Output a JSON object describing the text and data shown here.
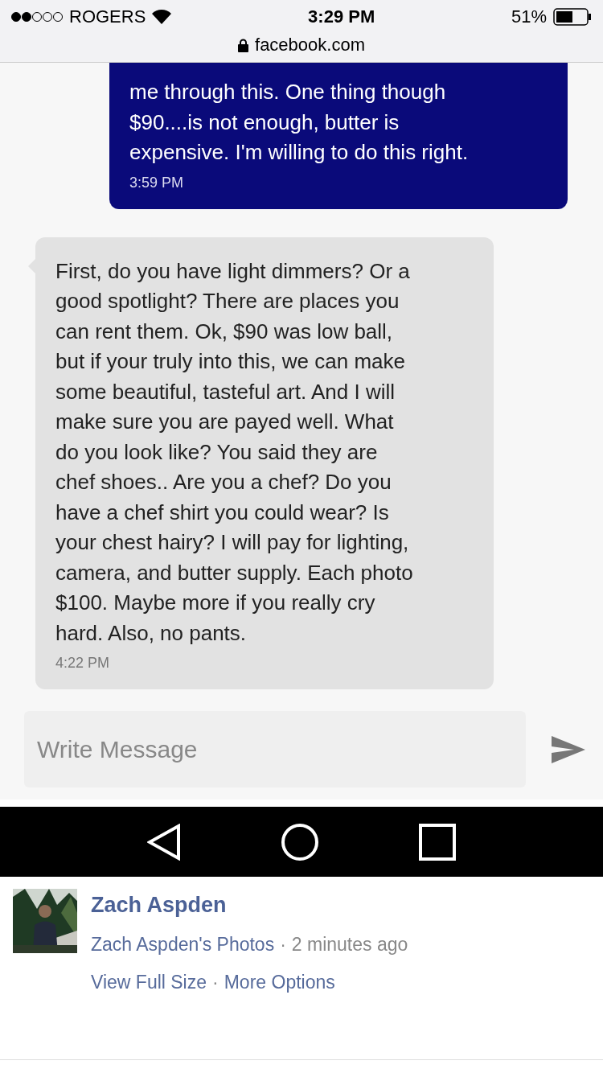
{
  "status_bar": {
    "carrier": "ROGERS",
    "time": "3:29 PM",
    "battery": "51%",
    "url": "facebook.com"
  },
  "messages": [
    {
      "kind": "sent",
      "text": "me through this. One thing though\n$90....is not enough, butter is\nexpensive. I'm willing to do this right.",
      "time": "3:59 PM"
    },
    {
      "kind": "received",
      "text": "First, do you have light dimmers? Or a\ngood spotlight? There are places you\ncan rent them. Ok, $90 was low ball,\nbut if your truly into this, we can make\nsome beautiful, tasteful art. And I will\nmake sure you are payed well. What\ndo you look like? You said they are\nchef shoes.. Are you a chef? Do you\nhave a chef shirt you could wear? Is\nyour chest hairy? I will pay for lighting,\ncamera, and butter supply. Each photo\n$100. Maybe more if you really cry\nhard. Also, no pants.",
      "time": "4:22 PM"
    }
  ],
  "composer": {
    "placeholder": "Write Message"
  },
  "post": {
    "author": "Zach Aspden",
    "album": "Zach Aspden's Photos",
    "separator": "·",
    "age": "2 minutes ago",
    "actions": [
      "View Full Size",
      "More Options"
    ]
  }
}
